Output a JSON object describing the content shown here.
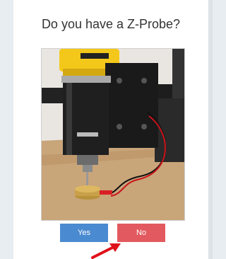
{
  "dialog": {
    "title": "Do you have a Z-Probe?",
    "image": {
      "alt_icon": "z-probe-photo"
    },
    "buttons": {
      "yes_label": "Yes",
      "no_label": "No"
    }
  },
  "colors": {
    "yes_button": "#4a8ad0",
    "no_button": "#e25a5f",
    "annotation_arrow": "#e0101a",
    "background": "#e8edf1"
  }
}
